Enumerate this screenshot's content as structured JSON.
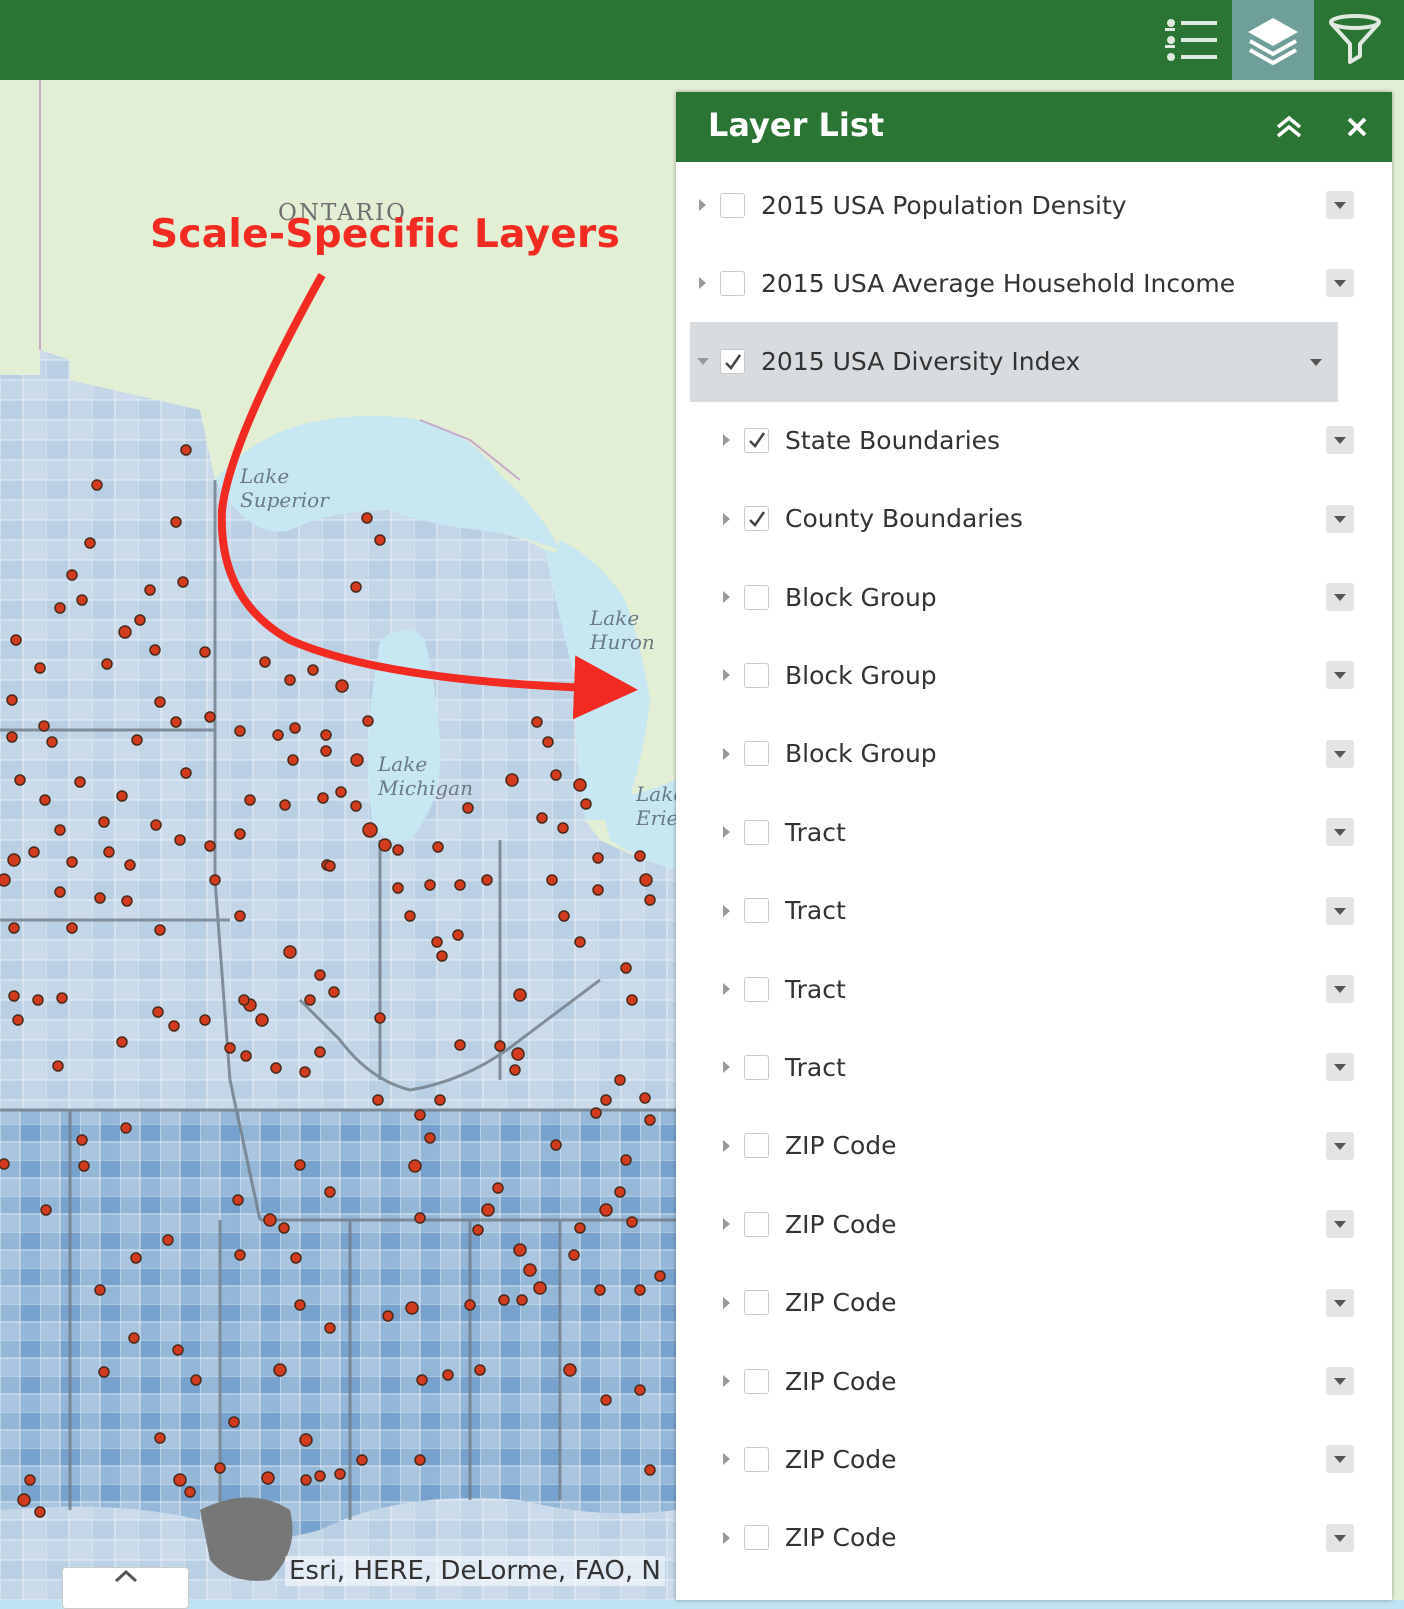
{
  "toolbar": {
    "buttons": [
      {
        "icon": "legend-icon",
        "active": false
      },
      {
        "icon": "layers-icon",
        "active": true
      },
      {
        "icon": "filter-icon",
        "active": false
      }
    ]
  },
  "map": {
    "annotation": "Scale-Specific Layers",
    "labels": {
      "ontario": "ONTARIO",
      "lake_superior": "Lake\nSuperior",
      "lake_michigan": "Lake\nMichigan",
      "lake_huron": "Lake\nHuron",
      "lake_erie": "Lake\nErie"
    },
    "attribution": "Esri, HERE, DeLorme, FAO, N",
    "colors": {
      "land": "#e3efd4",
      "water": "#c7e7f3",
      "choropleth_light": "#c3d6e8",
      "choropleth_mid": "#8fb3d6",
      "choropleth_dark": "#3b7cb5",
      "point": "#d23b1e",
      "annotation": "#f22b22"
    }
  },
  "panel": {
    "title": "Layer List",
    "collapse_icon": "double-chevron-up-icon",
    "close_icon": "close-icon",
    "header_color": "#2a7434",
    "layers": [
      {
        "name": "2015 USA Population Density",
        "checked": false,
        "level": 0,
        "expanded": false
      },
      {
        "name": "2015 USA Average Household Income",
        "checked": false,
        "level": 0,
        "expanded": false
      },
      {
        "name": "2015 USA Diversity Index",
        "checked": true,
        "level": 0,
        "expanded": true,
        "selected": true
      },
      {
        "name": "State Boundaries",
        "checked": true,
        "level": 1,
        "expanded": false
      },
      {
        "name": "County Boundaries",
        "checked": true,
        "level": 1,
        "expanded": false
      },
      {
        "name": "Block Group",
        "checked": false,
        "level": 1,
        "expanded": false
      },
      {
        "name": "Block Group",
        "checked": false,
        "level": 1,
        "expanded": false
      },
      {
        "name": "Block Group",
        "checked": false,
        "level": 1,
        "expanded": false
      },
      {
        "name": "Tract",
        "checked": false,
        "level": 1,
        "expanded": false
      },
      {
        "name": "Tract",
        "checked": false,
        "level": 1,
        "expanded": false
      },
      {
        "name": "Tract",
        "checked": false,
        "level": 1,
        "expanded": false
      },
      {
        "name": "Tract",
        "checked": false,
        "level": 1,
        "expanded": false
      },
      {
        "name": "ZIP Code",
        "checked": false,
        "level": 1,
        "expanded": false
      },
      {
        "name": "ZIP Code",
        "checked": false,
        "level": 1,
        "expanded": false
      },
      {
        "name": "ZIP Code",
        "checked": false,
        "level": 1,
        "expanded": false
      },
      {
        "name": "ZIP Code",
        "checked": false,
        "level": 1,
        "expanded": false
      },
      {
        "name": "ZIP Code",
        "checked": false,
        "level": 1,
        "expanded": false
      },
      {
        "name": "ZIP Code",
        "checked": false,
        "level": 1,
        "expanded": false
      }
    ]
  }
}
